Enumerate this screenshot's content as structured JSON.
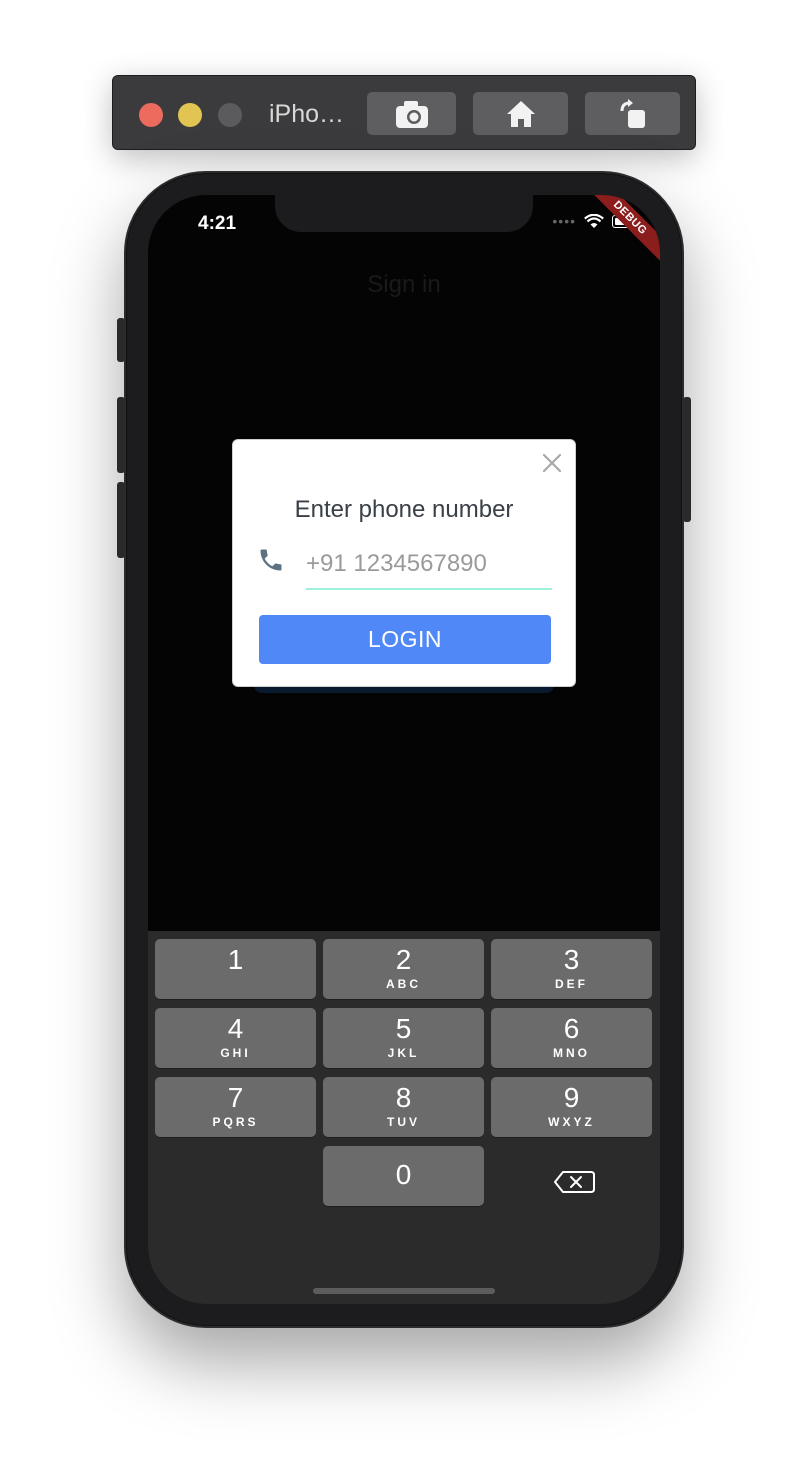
{
  "simulator": {
    "title": "iPho…"
  },
  "status_bar": {
    "time": "4:21",
    "debug_banner": "DEBUG"
  },
  "app": {
    "page_title": "Sign in"
  },
  "dialog": {
    "title": "Enter phone number",
    "phone_placeholder": "+91 1234567890",
    "login_label": "LOGIN"
  },
  "keypad": {
    "keys": [
      {
        "num": "1",
        "letters": ""
      },
      {
        "num": "2",
        "letters": "ABC"
      },
      {
        "num": "3",
        "letters": "DEF"
      },
      {
        "num": "4",
        "letters": "GHI"
      },
      {
        "num": "5",
        "letters": "JKL"
      },
      {
        "num": "6",
        "letters": "MNO"
      },
      {
        "num": "7",
        "letters": "PQRS"
      },
      {
        "num": "8",
        "letters": "TUV"
      },
      {
        "num": "9",
        "letters": "WXYZ"
      },
      {
        "num": "0",
        "letters": ""
      }
    ]
  },
  "colors": {
    "accent": "#5089f7",
    "input_underline": "#9fefdd",
    "debug_banner": "#8b1d1d"
  }
}
